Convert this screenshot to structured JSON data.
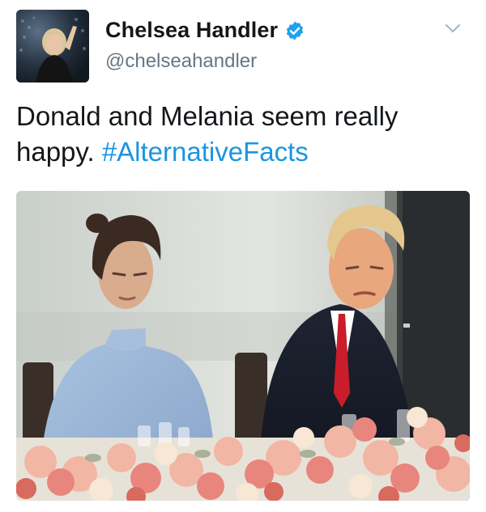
{
  "user": {
    "display_name": "Chelsea Handler",
    "handle": "@chelseahandler",
    "verified": true,
    "verified_color": "#1da1f2"
  },
  "tweet": {
    "text": "Donald and Melania seem really happy.",
    "hashtag": "#AlternativeFacts",
    "hashtag_color": "#1b95e0"
  },
  "icons": {
    "menu": "chevron-down-icon",
    "badge": "verified-badge-icon"
  },
  "media": {
    "type": "photo"
  }
}
